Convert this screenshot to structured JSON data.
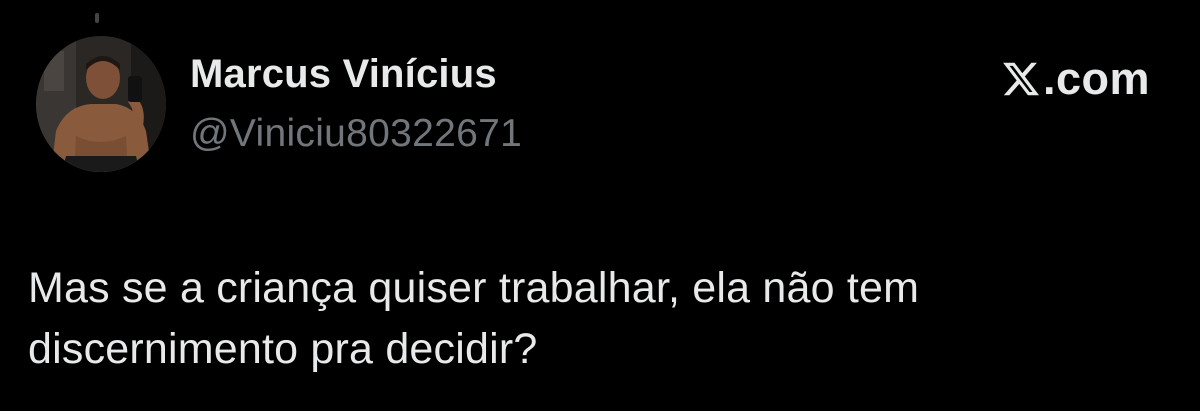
{
  "author": {
    "display_name": "Marcus Vinícius",
    "handle": "@Viniciu80322671",
    "avatar": "profile-photo"
  },
  "brand": {
    "icon": "x-logo-icon",
    "label": ".com"
  },
  "tweet": {
    "lines": [
      "Mas se a criança quiser trabalhar, ela não tem",
      "discernimento pra decidir?"
    ]
  },
  "colors": {
    "background": "#000000",
    "primary_text": "#e7e9ea",
    "secondary_text": "#71767b"
  }
}
